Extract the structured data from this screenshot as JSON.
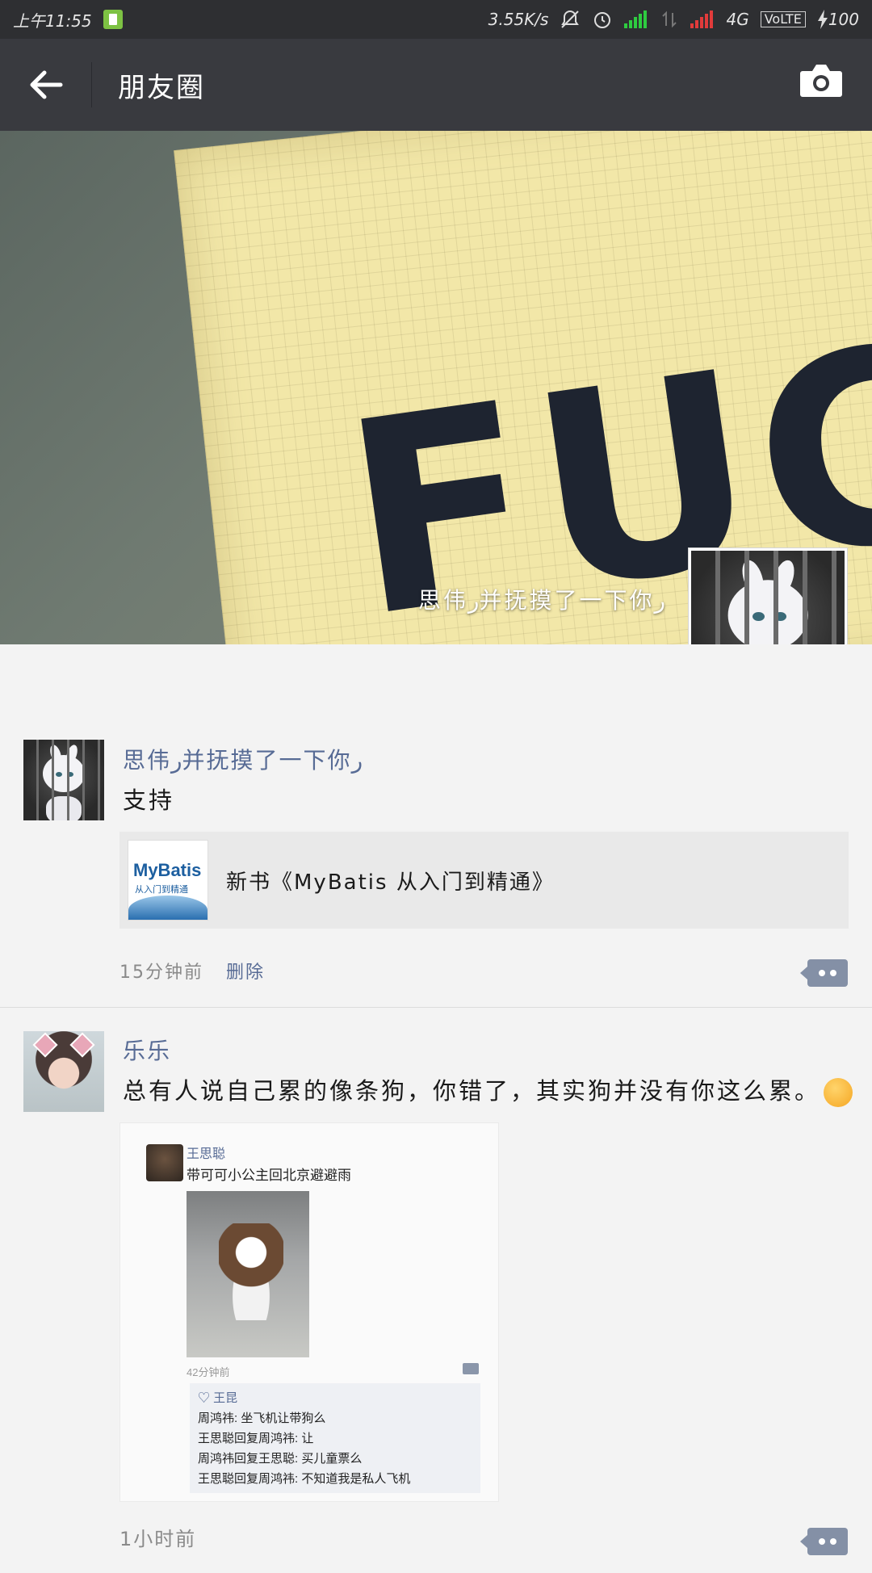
{
  "status_bar": {
    "time": "上午11:55",
    "speed": "3.55K/s",
    "network": "4G",
    "volte": "VoLTE",
    "battery": "100",
    "signal1_color": "#2ecc40",
    "signal2_color": "#e23b3b"
  },
  "header": {
    "title": "朋友圈",
    "back_icon": "back-arrow-icon",
    "camera_icon": "camera-icon"
  },
  "cover": {
    "word": "FUCK",
    "user_name": "思伟ر并抚摸了一下你ر"
  },
  "posts": [
    {
      "name": "思伟ر并抚摸了一下你ر",
      "text": "支持",
      "link": {
        "thumb_title": "MyBatis",
        "thumb_sub": "从入门到精通",
        "title": "新书《MyBatis 从入门到精通》"
      },
      "time": "15分钟前",
      "delete": "删除"
    },
    {
      "name": "乐乐",
      "text": "总有人说自己累的像条狗，你错了，其实狗并没有你这么累。",
      "shot": {
        "name": "王思聪",
        "text": "带可可小公主回北京避避雨",
        "time": "42分钟前",
        "like": "♡ 王昆",
        "comments": [
          "周鸿祎: 坐飞机让带狗么",
          "王思聪回复周鸿祎: 让",
          "周鸿祎回复王思聪: 买儿童票么",
          "王思聪回复周鸿祎: 不知道我是私人飞机"
        ]
      },
      "time": "1小时前"
    }
  ]
}
